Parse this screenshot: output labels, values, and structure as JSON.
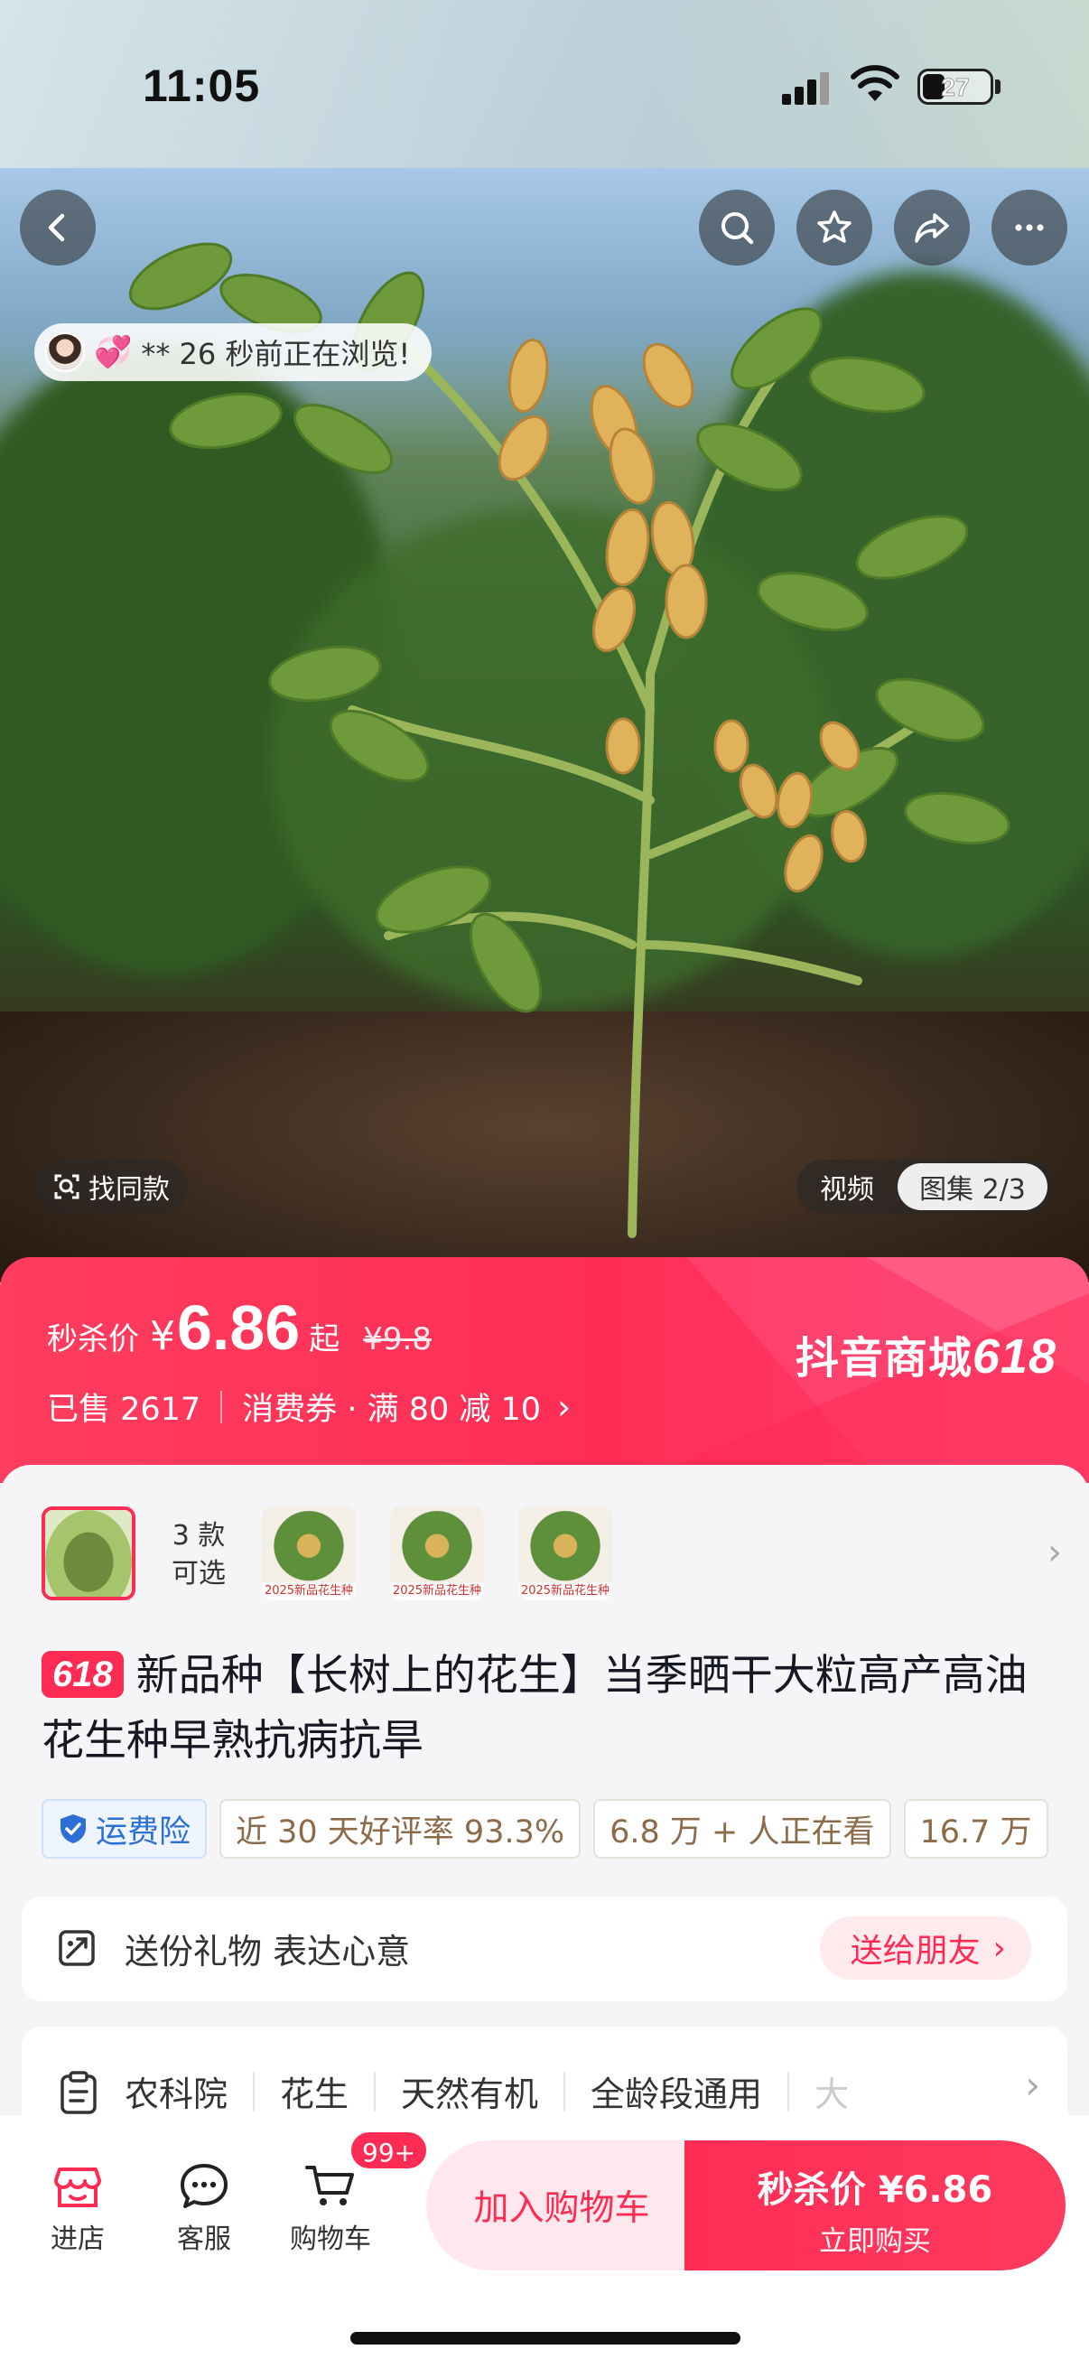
{
  "status_bar": {
    "time": "11:05",
    "battery": "27"
  },
  "hero": {
    "viewer_notice": "** 26 秒前正在浏览!",
    "find_same_label": "找同款",
    "media_tabs": {
      "video": "视频",
      "gallery": "图集 2/3"
    },
    "icons": [
      "back-icon",
      "search-icon",
      "star-icon",
      "share-icon",
      "more-icon"
    ]
  },
  "price": {
    "label": "秒杀价",
    "currency": "¥",
    "amount": "6.86",
    "suffix": "起",
    "original": "¥9.8",
    "sold": "已售 2617",
    "coupon": "消费券 · 满 80 减 10",
    "brand": "抖音商城",
    "brand_event": "618"
  },
  "variants": {
    "count_line1": "3 款",
    "count_line2": "可选",
    "thumb_caption": "2025新品花生种"
  },
  "product": {
    "event_tag": "618",
    "title": "新品种【长树上的花生】当季晒干大粒高产高油花生种早熟抗病抗旱"
  },
  "chips": [
    "运费险",
    "近 30 天好评率 93.3%",
    "6.8 万 + 人正在看",
    "16.7 万"
  ],
  "gift": {
    "text": "送份礼物 表达心意",
    "button": "送给朋友"
  },
  "attributes": [
    "农科院",
    "花生",
    "天然有机",
    "全龄段通用",
    "大"
  ],
  "bottom_bar": {
    "store": "进店",
    "service": "客服",
    "cart": "购物车",
    "cart_badge": "99+",
    "add_to_cart": "加入购物车",
    "buy_price": "秒杀价 ¥6.86",
    "buy_now": "立即购买"
  },
  "colors": {
    "accent": "#fe2c55",
    "chip_text": "#8b6b4a",
    "ship_blue": "#2c6fd6"
  }
}
